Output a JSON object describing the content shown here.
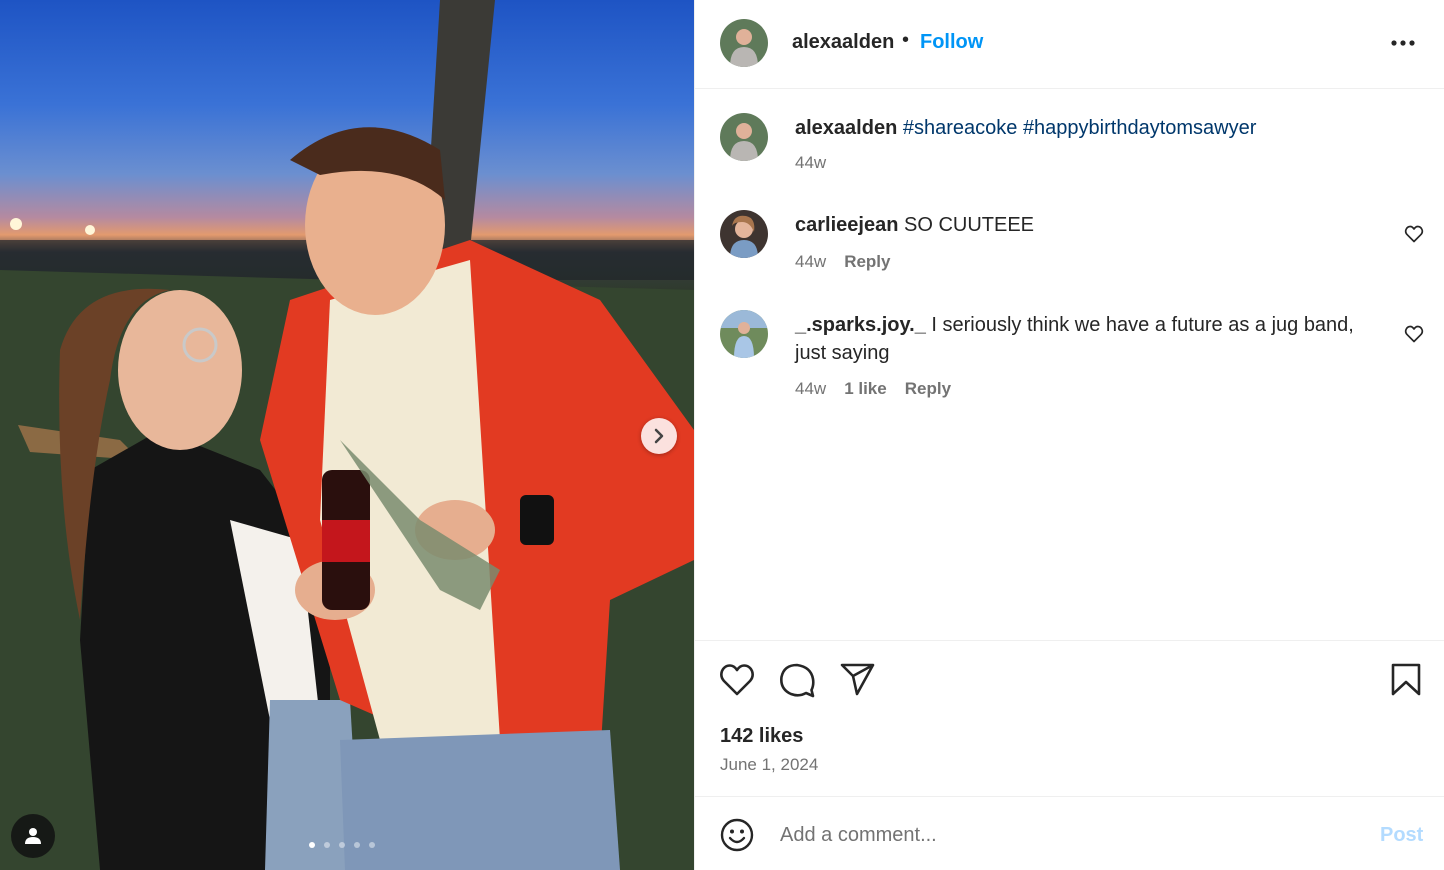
{
  "post": {
    "image_alt": "Photo of a young woman and a young man in a red jacket toasting Coca-Cola bottles at sunset",
    "carousel": {
      "total": 5,
      "active_index": 0
    }
  },
  "header": {
    "username": "alexaalden",
    "separator": "•",
    "follow_label": "Follow"
  },
  "comments": [
    {
      "username": "alexaalden",
      "text": "",
      "hashtags": "#shareacoke #happybirthdaytomsawyer",
      "time": "44w",
      "likes": "",
      "reply_label": ""
    },
    {
      "username": "carlieejean",
      "text": "SO CUUTEEE",
      "hashtags": "",
      "time": "44w",
      "likes": "",
      "reply_label": "Reply"
    },
    {
      "username": "_.sparks.joy._",
      "text": "I seriously think we have a future as a jug band, just saying",
      "hashtags": "",
      "time": "44w",
      "likes": "1 like",
      "reply_label": "Reply"
    }
  ],
  "actions": {
    "likes": "142 likes",
    "date": "June 1, 2024"
  },
  "add_comment": {
    "placeholder": "Add a comment...",
    "post_label": "Post"
  },
  "colors": {
    "accent": "#0095f6",
    "hashtag": "#00376b",
    "secondary_text": "#737373",
    "post_disabled": "#b3dbff"
  }
}
